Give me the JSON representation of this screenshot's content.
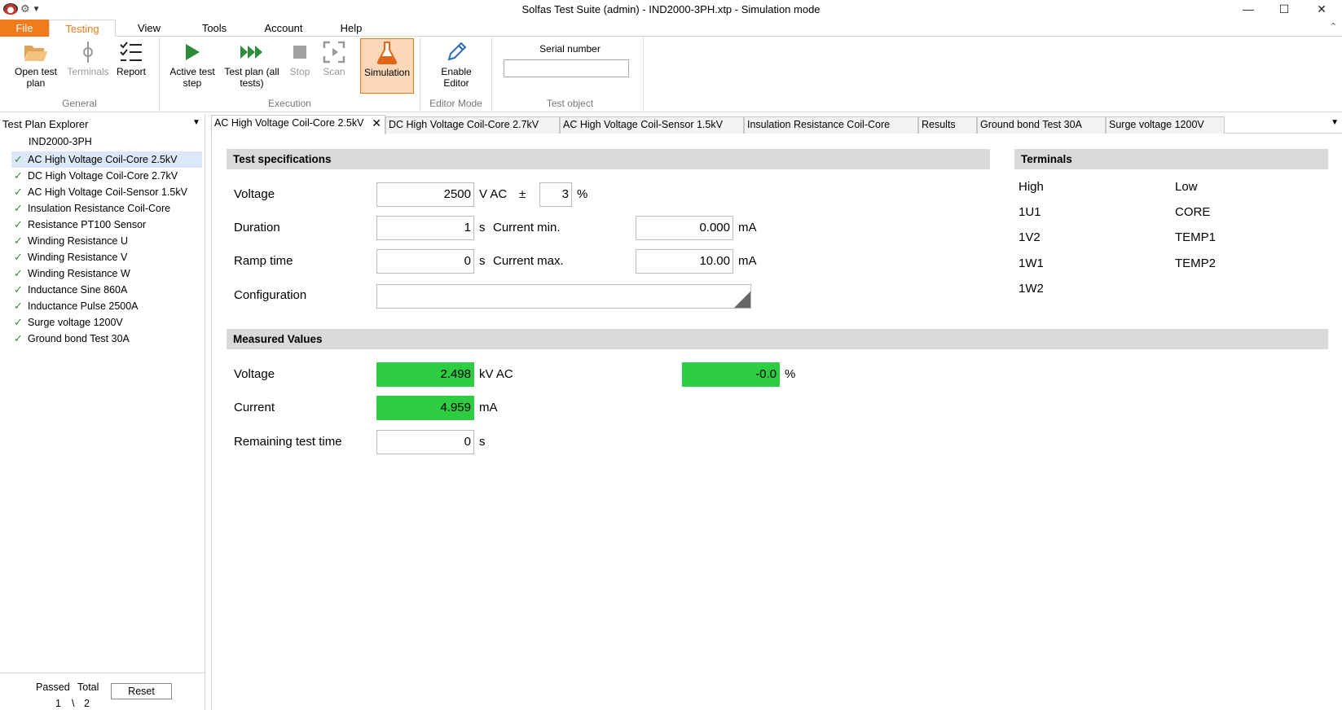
{
  "window": {
    "title": "Solfas Test Suite (admin)  - IND2000-3PH.xtp - Simulation mode",
    "controls": {
      "minimize": "—",
      "maximize": "☐",
      "close": "✕"
    }
  },
  "menu": {
    "file": "File",
    "tabs": [
      "Testing",
      "View",
      "Tools",
      "Account",
      "Help"
    ]
  },
  "ribbon": {
    "general": {
      "label": "General",
      "open_test_plan": "Open test plan",
      "terminals": "Terminals",
      "report": "Report"
    },
    "execution": {
      "label": "Execution",
      "active_test_step": "Active test step",
      "test_plan_all": "Test plan (all tests)",
      "stop": "Stop",
      "scan": "Scan",
      "simulation": "Simulation"
    },
    "editor_mode": {
      "label": "Editor Mode",
      "enable_editor": "Enable Editor"
    },
    "test_object": {
      "label": "Test object",
      "serial_label": "Serial number",
      "serial_value": ""
    }
  },
  "explorer": {
    "title": "Test Plan Explorer",
    "root": "IND2000-3PH",
    "items": [
      "AC High Voltage Coil-Core 2.5kV",
      "DC High Voltage Coil-Core 2.7kV",
      "AC High Voltage Coil-Sensor 1.5kV",
      "Insulation Resistance Coil-Core",
      "Resistance PT100 Sensor",
      "Winding Resistance U",
      "Winding Resistance  V",
      "Winding Resistance  W",
      "Inductance Sine 860A",
      "Inductance Pulse 2500A",
      "Surge voltage 1200V",
      "Ground bond Test 30A"
    ],
    "footer": {
      "passed_label": "Passed",
      "total_label": "Total",
      "passed": "1",
      "separator": "\\",
      "total": "2",
      "reset": "Reset"
    }
  },
  "doc_tabs": [
    "AC High Voltage Coil-Core 2.5kV",
    "DC High Voltage Coil-Core 2.7kV",
    "AC High Voltage Coil-Sensor 1.5kV",
    "Insulation Resistance Coil-Core",
    "Results",
    "Ground bond Test 30A",
    "Surge voltage 1200V"
  ],
  "spec": {
    "title": "Test specifications",
    "voltage_label": "Voltage",
    "voltage": "2500",
    "voltage_unit": "V AC",
    "pm": "±",
    "tolerance": "3",
    "tolerance_unit": "%",
    "duration_label": "Duration",
    "duration": "1",
    "duration_unit": "s",
    "current_min_label": "Current min.",
    "current_min": "0.000",
    "current_min_unit": "mA",
    "ramp_label": "Ramp time",
    "ramp": "0",
    "ramp_unit": "s",
    "current_max_label": "Current max.",
    "current_max": "10.00",
    "current_max_unit": "mA",
    "config_label": "Configuration"
  },
  "terminals": {
    "title": "Terminals",
    "high_label": "High",
    "low_label": "Low",
    "high": [
      "1U1",
      "1V2",
      "1W1",
      "1W2"
    ],
    "low": [
      "CORE",
      "TEMP1",
      "TEMP2"
    ]
  },
  "measured": {
    "title": "Measured Values",
    "voltage_label": "Voltage",
    "voltage": "2.498",
    "voltage_unit": "kV AC",
    "deviation": "-0.0",
    "deviation_unit": "%",
    "current_label": "Current",
    "current": "4.959",
    "current_unit": "mA",
    "remaining_label": "Remaining test time",
    "remaining": "0",
    "remaining_unit": "s"
  },
  "colors": {
    "accent": "#f07b1a",
    "pass": "#2ecc40",
    "check": "#2e8b3a"
  }
}
